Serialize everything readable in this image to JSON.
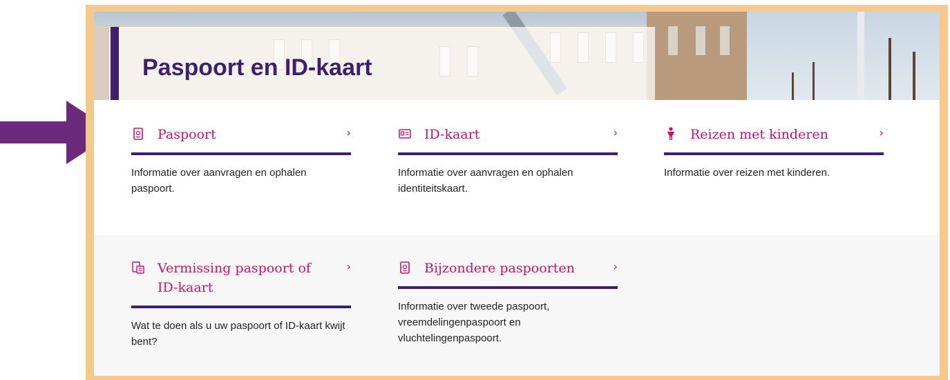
{
  "page": {
    "title": "Paspoort en ID-kaart"
  },
  "cards": [
    {
      "title": "Paspoort",
      "description": "Informatie over aanvragen en ophalen paspoort.",
      "icon": "passport-icon",
      "chevron": "›"
    },
    {
      "title": "ID-kaart",
      "description": "Informatie over aanvragen en ophalen identiteitskaart.",
      "icon": "id-card-icon",
      "chevron": "›"
    },
    {
      "title": "Reizen met kinderen",
      "description": "Informatie over reizen met kinderen.",
      "icon": "child-icon",
      "chevron": "›"
    },
    {
      "title": "Vermissing paspoort of ID-kaart",
      "description": "Wat te doen als u uw paspoort of ID-kaart kwijt bent?",
      "icon": "lost-document-icon",
      "chevron": "›"
    },
    {
      "title": "Bijzondere paspoorten",
      "description": "Informatie over tweede paspoort, vreemdelingenpaspoort en vluchtelingenpaspoort.",
      "icon": "passport-icon",
      "chevron": "›"
    }
  ],
  "colors": {
    "accent": "#c8116b",
    "brand": "#3d1f6e",
    "frame": "#f5c88c",
    "arrow": "#6b2a7c"
  }
}
